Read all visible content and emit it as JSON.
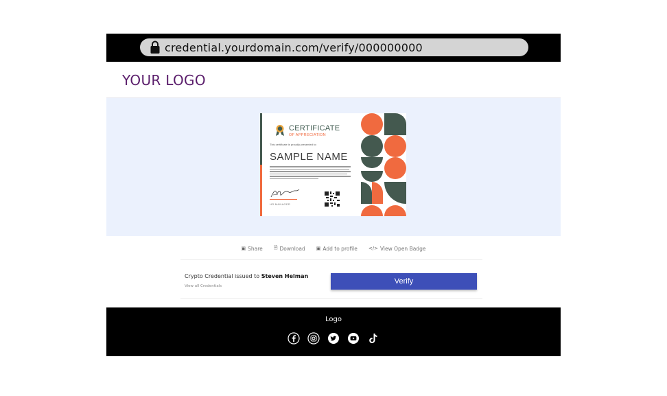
{
  "browser": {
    "url": "credential.yourdomain.com/verify/000000000"
  },
  "header": {
    "logo_text": "YOUR LOGO"
  },
  "certificate": {
    "title": "CERTIFICATE",
    "subtitle": "OF APPRECIATION",
    "presented_text": "This certificate is proudly presented to:",
    "name": "SAMPLE NAME",
    "signer_role": "HR MANAGER"
  },
  "actions": {
    "share_label": "Share",
    "download_label": "Download",
    "add_profile_label": "Add to profile",
    "view_badge_label": "View Open Badge"
  },
  "credential": {
    "issued_prefix": "Crypto Credential issued to",
    "recipient": "Steven Helman",
    "view_all_label": "View all Credentials",
    "verify_label": "Verify"
  },
  "footer": {
    "logo_text": "Logo",
    "social_icons": [
      "facebook-icon",
      "instagram-icon",
      "twitter-icon",
      "youtube-icon",
      "tiktok-icon"
    ]
  },
  "colors": {
    "accent_blue": "#3d4fb8",
    "logo_purple": "#5a1d6b",
    "cert_green": "#44594f",
    "cert_orange": "#f06a3f",
    "hero_bg": "#ebf1fd"
  }
}
